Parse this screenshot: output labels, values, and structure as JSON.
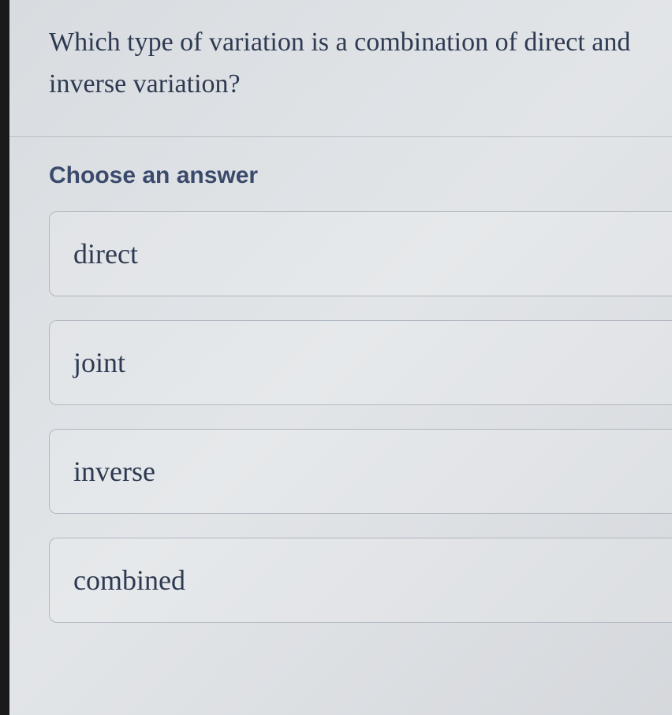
{
  "question": {
    "text": "Which type of variation is a combination of direct and inverse variation?"
  },
  "instruction": "Choose an answer",
  "options": [
    {
      "label": "direct"
    },
    {
      "label": "joint"
    },
    {
      "label": "inverse"
    },
    {
      "label": "combined"
    }
  ]
}
